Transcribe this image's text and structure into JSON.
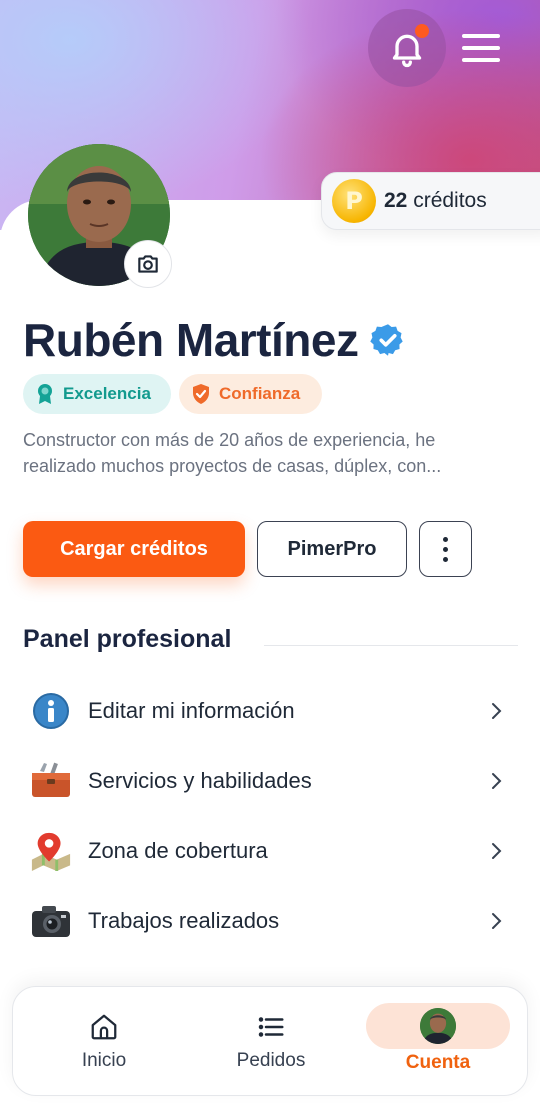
{
  "header": {
    "notification_icon": "bell-icon",
    "menu_icon": "hamburger-menu-icon",
    "credits": {
      "icon": "coin-icon",
      "coin_glyph": "P",
      "amount": "22",
      "unit": "créditos"
    }
  },
  "profile": {
    "name": "Rubén Martínez",
    "verified_icon": "verified-check-icon",
    "camera_icon": "camera-icon",
    "badges": [
      {
        "label": "Excelencia",
        "icon": "award-ribbon-icon",
        "color": "#129a8e",
        "bg": "#dff4f3"
      },
      {
        "label": "Confianza",
        "icon": "shield-check-icon",
        "color": "#ef6a2a",
        "bg": "#fdecdf"
      }
    ],
    "bio_line_1": "Constructor con más de 20 años de experiencia, he",
    "bio_line_2": "realizado muchos proyectos de casas, dúplex, con..."
  },
  "actions": {
    "load_credits": "Cargar créditos",
    "pimerpro": "PimerPro",
    "more_icon": "more-vertical-icon"
  },
  "panel": {
    "title": "Panel profesional",
    "items": [
      {
        "label": "Editar mi información",
        "icon": "info-icon"
      },
      {
        "label": "Servicios y habilidades",
        "icon": "toolbox-icon"
      },
      {
        "label": "Zona de cobertura",
        "icon": "map-pin-icon"
      },
      {
        "label": "Trabajos realizados",
        "icon": "camera-icon"
      }
    ]
  },
  "tabbar": {
    "tabs": [
      {
        "label": "Inicio",
        "icon": "home-icon"
      },
      {
        "label": "Pedidos",
        "icon": "list-icon"
      },
      {
        "label": "Cuenta",
        "icon": "avatar",
        "active": true
      }
    ]
  },
  "colors": {
    "accent": "#fb5a12",
    "name": "#1b2540",
    "verified": "#3b9be8"
  }
}
